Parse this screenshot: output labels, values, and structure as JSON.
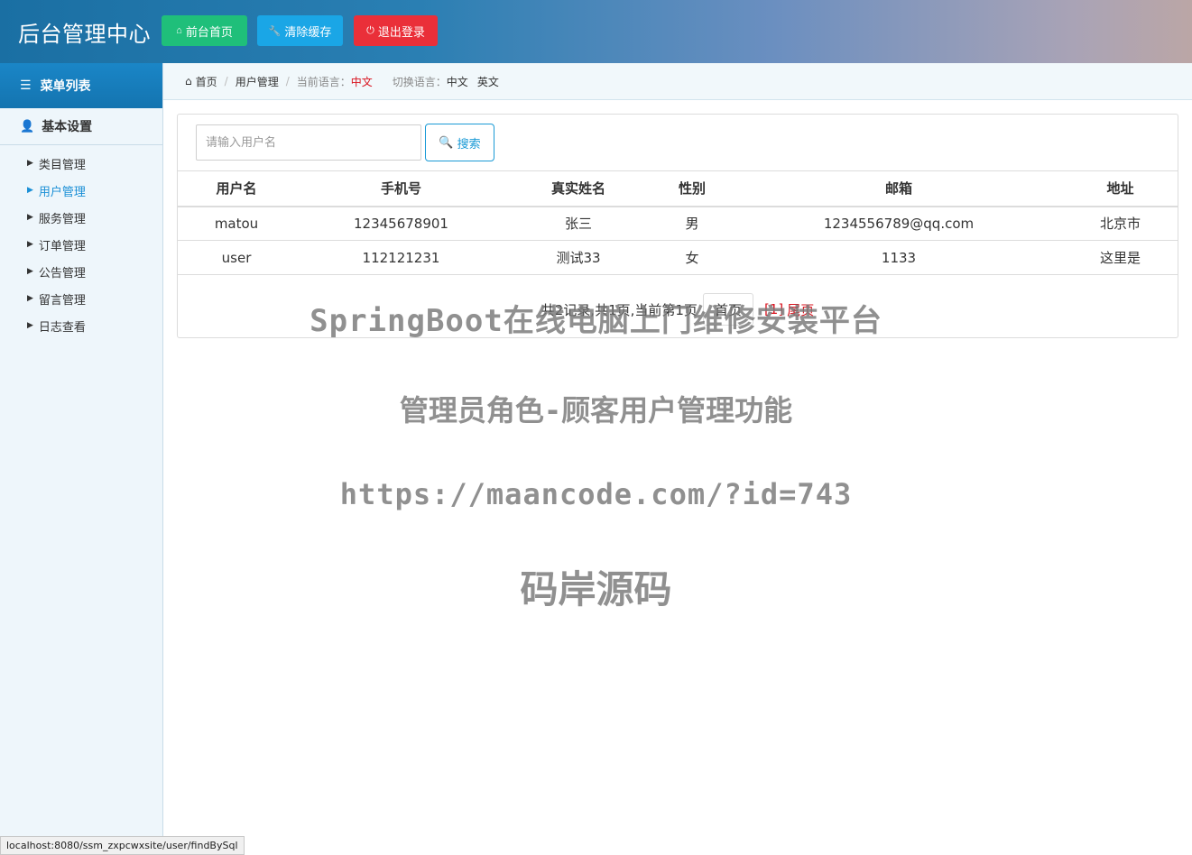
{
  "header": {
    "title": "后台管理中心",
    "buttons": {
      "home": "前台首页",
      "clear_cache": "清除缓存",
      "logout": "退出登录"
    }
  },
  "sidebar": {
    "menu_title": "菜单列表",
    "group_title": "基本设置",
    "items": [
      {
        "label": "类目管理"
      },
      {
        "label": "用户管理"
      },
      {
        "label": "服务管理"
      },
      {
        "label": "订单管理"
      },
      {
        "label": "公告管理"
      },
      {
        "label": "留言管理"
      },
      {
        "label": "日志查看"
      }
    ]
  },
  "breadcrumb": {
    "home": "首页",
    "current": "用户管理",
    "lang_label": "当前语言：",
    "lang_value": "中文",
    "switch_label": "切换语言：",
    "switch_zh": "中文",
    "switch_en": "英文"
  },
  "search": {
    "placeholder": "请输入用户名",
    "value": "",
    "button": "搜索"
  },
  "table": {
    "headers": [
      "用户名",
      "手机号",
      "真实姓名",
      "性别",
      "邮箱",
      "地址"
    ],
    "rows": [
      [
        "matou",
        "12345678901",
        "张三",
        "男",
        "1234556789@qq.com",
        "北京市"
      ],
      [
        "user",
        "112121231",
        "测试33",
        "女",
        "1133",
        "这里是"
      ]
    ]
  },
  "pager": {
    "summary": "共2记录,共1页,当前第1页",
    "first": "首页",
    "current": "[1]",
    "last": "尾页"
  },
  "watermark": {
    "line1": "SpringBoot在线电脑上门维修安装平台",
    "line2": "管理员角色-顾客用户管理功能",
    "line3": "https://maancode.com/?id=743",
    "line4": "码岸源码"
  },
  "status_url": "localhost:8080/ssm_zxpcwxsite/user/findBySql",
  "icons": {
    "home": "home-icon",
    "wrench": "wrench-icon",
    "power": "power-icon",
    "list": "list-icon",
    "user": "user-icon",
    "search": "search-icon",
    "caret": "caret-right-icon"
  }
}
